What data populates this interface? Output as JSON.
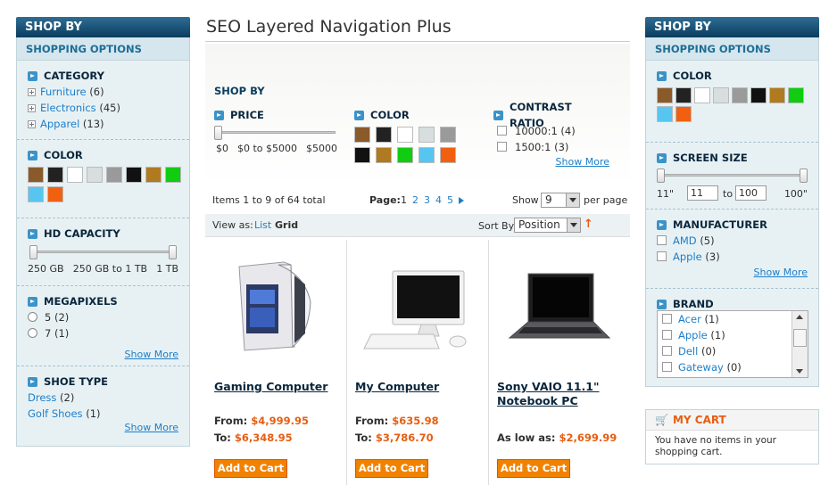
{
  "page_title": "SEO Layered Navigation Plus",
  "left": {
    "shop_by": "SHOP BY",
    "shopping_options": "SHOPPING OPTIONS",
    "category": {
      "title": "CATEGORY",
      "items": [
        {
          "label": "Furniture",
          "count": "(6)"
        },
        {
          "label": "Electronics",
          "count": "(45)"
        },
        {
          "label": "Apparel",
          "count": "(13)"
        }
      ]
    },
    "color": {
      "title": "COLOR"
    },
    "hd_capacity": {
      "title": "HD CAPACITY",
      "min": "250 GB",
      "range": "250 GB to 1 TB",
      "max": "1 TB"
    },
    "megapixels": {
      "title": "MEGAPIXELS",
      "items": [
        "5 (2)",
        "7 (1)"
      ],
      "show_more": "Show More"
    },
    "shoe_type": {
      "title": "SHOE TYPE",
      "items": [
        {
          "label": "Dress",
          "count": "(2)"
        },
        {
          "label": "Golf Shoes",
          "count": "(1)"
        }
      ],
      "show_more": "Show More"
    }
  },
  "main": {
    "shop_by": "SHOP BY",
    "price": {
      "title": "PRICE",
      "min": "$0",
      "range": "$0 to $5000",
      "max": "$5000"
    },
    "color": {
      "title": "COLOR"
    },
    "contrast": {
      "title": "CONTRAST RATIO",
      "items": [
        "10000:1 (4)",
        "1500:1 (3)"
      ],
      "show_more": "Show More"
    },
    "toolbar": {
      "items_text": "Items 1 to 9 of 64 total",
      "page_label": "Page:",
      "pages": [
        "1",
        "2",
        "3",
        "4",
        "5"
      ],
      "show_label": "Show",
      "show_value": "9",
      "per_page": "per page",
      "view_as": "View as:",
      "list": "List",
      "grid": "Grid",
      "sort_by": "Sort By",
      "sort_value": "Position"
    },
    "products": [
      {
        "name": "Gaming Computer",
        "line1_label": "From:",
        "line1_value": "$4,999.95",
        "line2_label": "To:",
        "line2_value": "$6,348.95",
        "button": "Add to Cart"
      },
      {
        "name": "My Computer",
        "line1_label": "From:",
        "line1_value": "$635.98",
        "line2_label": "To:",
        "line2_value": "$3,786.70",
        "button": "Add to Cart"
      },
      {
        "name": "Sony VAIO 11.1\" Notebook PC",
        "line1_label": "As low as:",
        "line1_value": "$2,699.99",
        "button": "Add to Cart"
      }
    ]
  },
  "right": {
    "shop_by": "SHOP BY",
    "shopping_options": "SHOPPING OPTIONS",
    "color": {
      "title": "COLOR"
    },
    "screen_size": {
      "title": "SCREEN SIZE",
      "min": "11\"",
      "from": "11",
      "to_label": "to",
      "to": "100",
      "max": "100\""
    },
    "manufacturer": {
      "title": "MANUFACTURER",
      "items": [
        {
          "label": "AMD",
          "count": "(5)"
        },
        {
          "label": "Apple",
          "count": "(3)"
        }
      ],
      "show_more": "Show More"
    },
    "brand": {
      "title": "BRAND",
      "items": [
        {
          "label": "Acer",
          "count": "(1)"
        },
        {
          "label": "Apple",
          "count": "(1)"
        },
        {
          "label": "Dell",
          "count": "(0)"
        },
        {
          "label": "Gateway",
          "count": "(0)"
        }
      ]
    },
    "cart": {
      "title": "MY CART",
      "text": "You have no items in your shopping cart."
    }
  },
  "swatch_colors": {
    "row1": [
      "#8a5a2b",
      "#222222",
      "#ffffff",
      "#d8dede",
      "#9a9a9a",
      "#111111",
      "#b07a20"
    ],
    "row2": [
      "#11cc11",
      "#56c6f0",
      "#f06010"
    ]
  }
}
